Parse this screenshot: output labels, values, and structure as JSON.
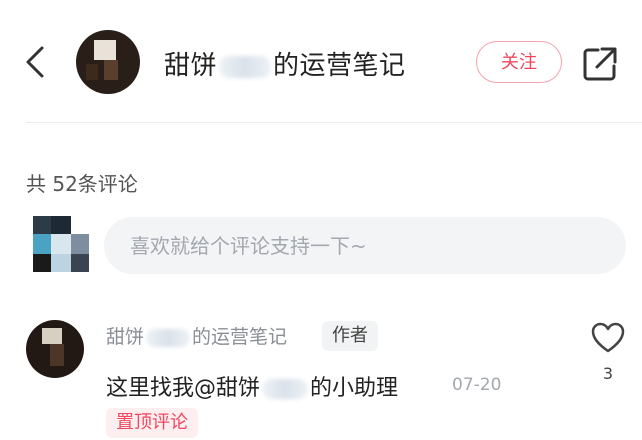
{
  "header": {
    "account_name_prefix": "甜饼",
    "account_name_suffix": "的运营笔记",
    "follow_label": "关注"
  },
  "comments_section": {
    "count_label": "共 52条评论",
    "input_placeholder": "喜欢就给个评论支持一下~"
  },
  "comment": {
    "author_prefix": "甜饼",
    "author_suffix": "的运营笔记",
    "author_badge": "作者",
    "text_prefix": "这里找我@甜饼",
    "text_suffix": "的小助理",
    "date": "07-20",
    "pin_label": "置顶评论",
    "like_count": "3"
  },
  "icons": {
    "back": "chevron-left-icon",
    "share": "share-out-icon",
    "like": "heart-outline-icon"
  },
  "colors": {
    "accent": "#f0485f",
    "accent_border": "#f2a3ad",
    "input_bg": "#f3f4f6"
  }
}
